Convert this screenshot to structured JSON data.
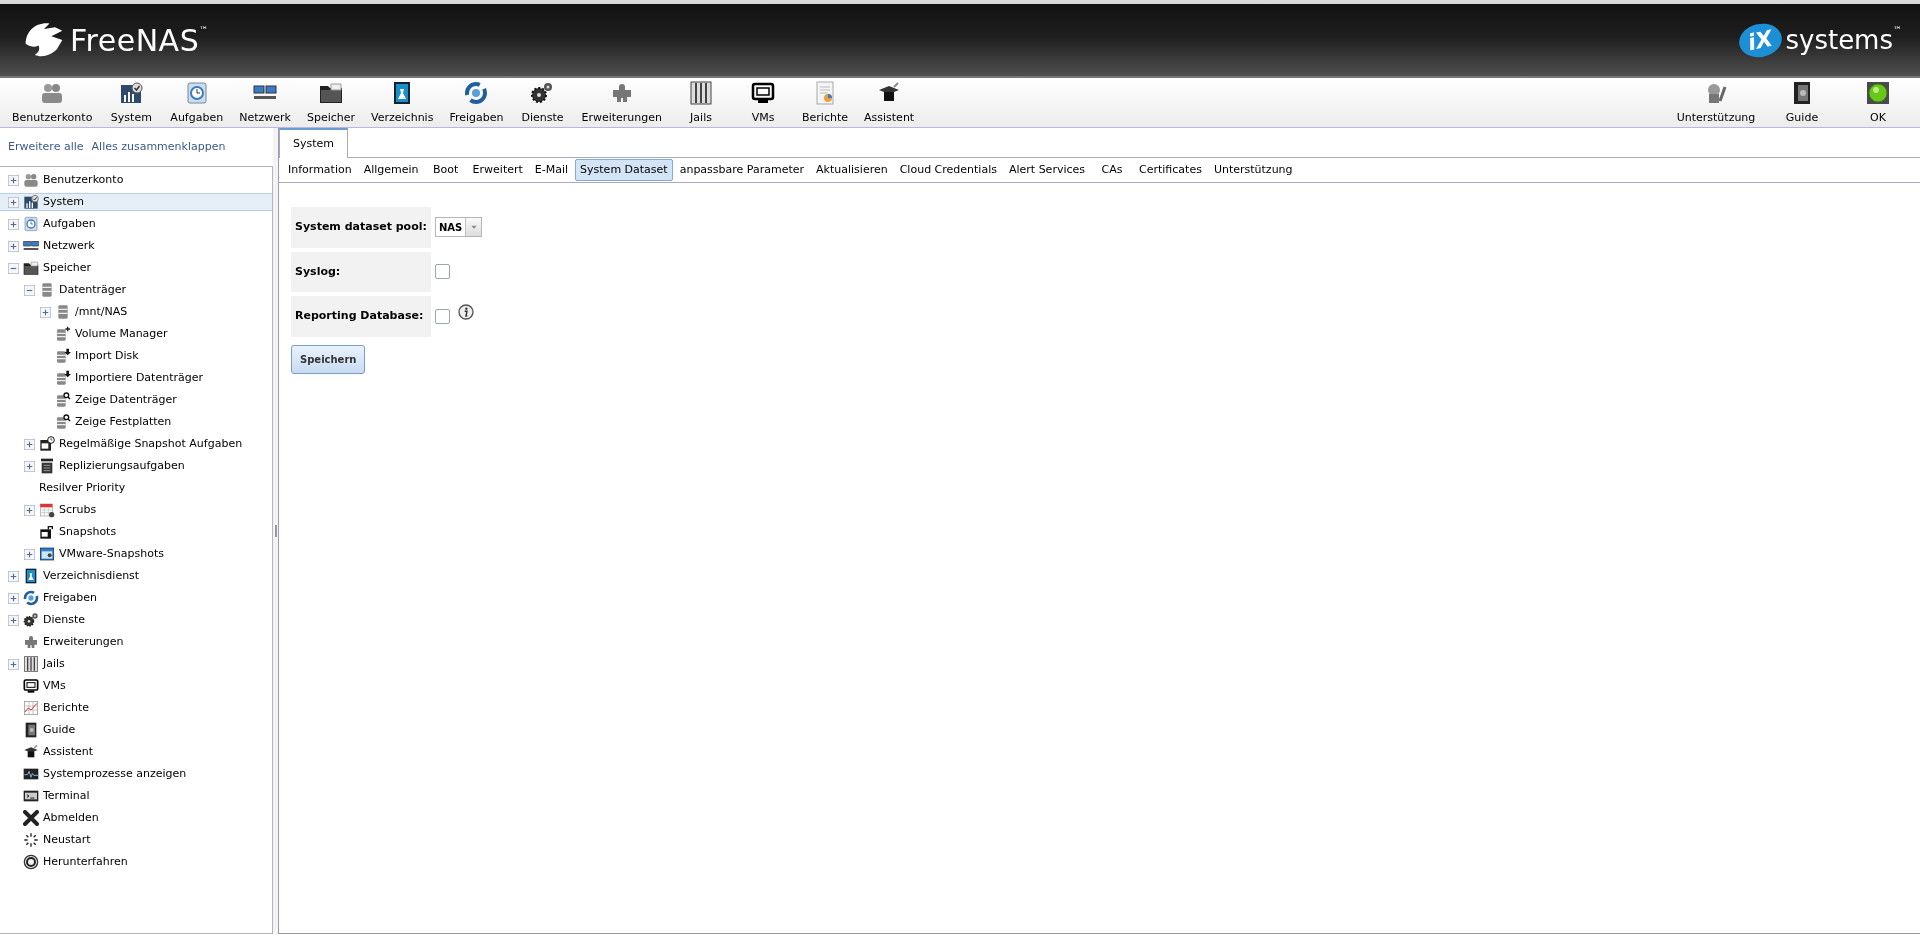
{
  "header": {
    "logo": "FreeNAS",
    "logo_tm": "™",
    "vendor_badge": "iX",
    "vendor": "systems",
    "vendor_tm": "™"
  },
  "toolbar": {
    "left": [
      "Benutzerkonto",
      "System",
      "Aufgaben",
      "Netzwerk",
      "Speicher",
      "Verzeichnis",
      "Freigaben",
      "Dienste",
      "Erweiterungen",
      "Jails",
      "VMs",
      "Berichte",
      "Assistent"
    ],
    "right": [
      "Unterstützung",
      "Guide",
      "OK"
    ]
  },
  "sidebar": {
    "links": [
      "Erweitere alle",
      "Alles zusammenklappen"
    ],
    "tree": [
      {
        "label": "Benutzerkonto",
        "kind": "branch",
        "expanded": false,
        "selected": false
      },
      {
        "label": "System",
        "kind": "branch",
        "expanded": false,
        "selected": true
      },
      {
        "label": "Aufgaben",
        "kind": "branch",
        "expanded": false,
        "selected": false
      },
      {
        "label": "Netzwerk",
        "kind": "branch",
        "expanded": false,
        "selected": false
      },
      {
        "label": "Speicher",
        "kind": "branch",
        "expanded": true,
        "selected": false,
        "children": [
          {
            "label": "Datenträger",
            "kind": "branch",
            "expanded": true,
            "selected": false,
            "children": [
              {
                "label": "/mnt/NAS",
                "kind": "branch",
                "expanded": false,
                "selected": false
              },
              {
                "label": "Volume Manager",
                "kind": "leaf",
                "selected": false
              },
              {
                "label": "Import Disk",
                "kind": "leaf",
                "selected": false
              },
              {
                "label": "Importiere Datenträger",
                "kind": "leaf",
                "selected": false
              },
              {
                "label": "Zeige Datenträger",
                "kind": "leaf",
                "selected": false
              },
              {
                "label": "Zeige Festplatten",
                "kind": "leaf",
                "selected": false
              }
            ]
          },
          {
            "label": "Regelmäßige Snapshot Aufgaben",
            "kind": "branch",
            "expanded": false,
            "selected": false
          },
          {
            "label": "Replizierungsaufgaben",
            "kind": "branch",
            "expanded": false,
            "selected": false
          },
          {
            "label": "Resilver Priority",
            "kind": "leaf",
            "selected": false
          },
          {
            "label": "Scrubs",
            "kind": "branch",
            "expanded": false,
            "selected": false
          },
          {
            "label": "Snapshots",
            "kind": "leaf",
            "selected": false
          },
          {
            "label": "VMware-Snapshots",
            "kind": "branch",
            "expanded": false,
            "selected": false
          }
        ]
      },
      {
        "label": "Verzeichnisdienst",
        "kind": "branch",
        "expanded": false,
        "selected": false
      },
      {
        "label": "Freigaben",
        "kind": "branch",
        "expanded": false,
        "selected": false
      },
      {
        "label": "Dienste",
        "kind": "branch",
        "expanded": false,
        "selected": false
      },
      {
        "label": "Erweiterungen",
        "kind": "leaf",
        "selected": false
      },
      {
        "label": "Jails",
        "kind": "branch",
        "expanded": false,
        "selected": false
      },
      {
        "label": "VMs",
        "kind": "leaf",
        "selected": false
      },
      {
        "label": "Berichte",
        "kind": "leaf",
        "selected": false
      },
      {
        "label": "Guide",
        "kind": "leaf",
        "selected": false
      },
      {
        "label": "Assistent",
        "kind": "leaf",
        "selected": false
      },
      {
        "label": "Systemprozesse anzeigen",
        "kind": "leaf",
        "selected": false
      },
      {
        "label": "Terminal",
        "kind": "leaf",
        "selected": false
      },
      {
        "label": "Abmelden",
        "kind": "leaf",
        "selected": false
      },
      {
        "label": "Neustart",
        "kind": "leaf",
        "selected": false
      },
      {
        "label": "Herunterfahren",
        "kind": "leaf",
        "selected": false
      }
    ]
  },
  "tabs": [
    {
      "label": "System",
      "selected": true
    }
  ],
  "subtabs": [
    {
      "label": "Information",
      "selected": false
    },
    {
      "label": "Allgemein",
      "selected": false
    },
    {
      "label": "Boot",
      "selected": false
    },
    {
      "label": "Erweitert",
      "selected": false
    },
    {
      "label": "E-Mail",
      "selected": false
    },
    {
      "label": "System Dataset",
      "selected": true
    },
    {
      "label": "anpassbare Parameter",
      "selected": false
    },
    {
      "label": "Aktualisieren",
      "selected": false
    },
    {
      "label": "Cloud Credentials",
      "selected": false
    },
    {
      "label": "Alert Services",
      "selected": false
    },
    {
      "label": "CAs",
      "selected": false
    },
    {
      "label": "Certificates",
      "selected": false
    },
    {
      "label": "Unterstützung",
      "selected": false
    }
  ],
  "form": {
    "fields": [
      {
        "label": "System dataset pool:",
        "kind": "select",
        "value": "NAS",
        "help": false
      },
      {
        "label": "Syslog:",
        "kind": "checkbox",
        "checked": false,
        "help": false
      },
      {
        "label": "Reporting Database:",
        "kind": "checkbox",
        "checked": false,
        "help": true
      }
    ],
    "button": "Speichern"
  }
}
